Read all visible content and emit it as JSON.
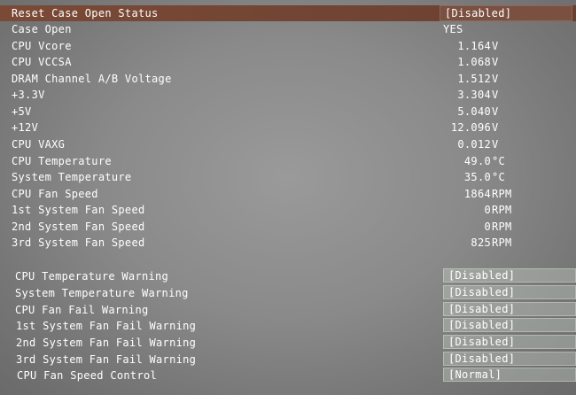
{
  "reset_case": {
    "label": "Reset Case Open Status",
    "option": "[Disabled]"
  },
  "case_open": {
    "label": "Case Open",
    "value": "YES"
  },
  "readings": [
    {
      "label": "CPU Vcore",
      "value": "1.164",
      "unit": "V"
    },
    {
      "label": "CPU VCCSA",
      "value": "1.068",
      "unit": "V"
    },
    {
      "label": "DRAM Channel A/B Voltage",
      "value": "1.512",
      "unit": "V"
    },
    {
      "label": "+3.3V",
      "value": "3.304",
      "unit": "V"
    },
    {
      "label": "+5V",
      "value": "5.040",
      "unit": "V"
    },
    {
      "label": "+12V",
      "value": "12.096",
      "unit": "V"
    },
    {
      "label": "CPU VAXG",
      "value": "0.012",
      "unit": "V"
    },
    {
      "label": "CPU Temperature",
      "value": "49.0",
      "unit": "°C"
    },
    {
      "label": "System Temperature",
      "value": "35.0",
      "unit": "°C"
    },
    {
      "label": "CPU Fan Speed",
      "value": "1864",
      "unit": "RPM"
    },
    {
      "label": "1st System Fan Speed",
      "value": "0",
      "unit": "RPM"
    },
    {
      "label": "2nd System Fan Speed",
      "value": "0",
      "unit": "RPM"
    },
    {
      "label": "3rd System Fan Speed",
      "value": "825",
      "unit": "RPM"
    }
  ],
  "settings": [
    {
      "label": "CPU Temperature Warning",
      "option": "[Disabled]"
    },
    {
      "label": "System Temperature Warning",
      "option": "[Disabled]"
    },
    {
      "label": "CPU Fan Fail Warning",
      "option": "[Disabled]"
    },
    {
      "label": "1st System Fan Fail Warning",
      "option": "[Disabled]"
    },
    {
      "label": "2nd System Fan Fail Warning",
      "option": "[Disabled]"
    },
    {
      "label": "3rd System Fan Fail Warning",
      "option": "[Disabled]"
    },
    {
      "label": "CPU Fan Speed Control",
      "option": "[Normal]"
    }
  ],
  "colors": {
    "selected_row": "#7a4a36",
    "text": "#ffffff",
    "background": "#8a8a8a"
  }
}
